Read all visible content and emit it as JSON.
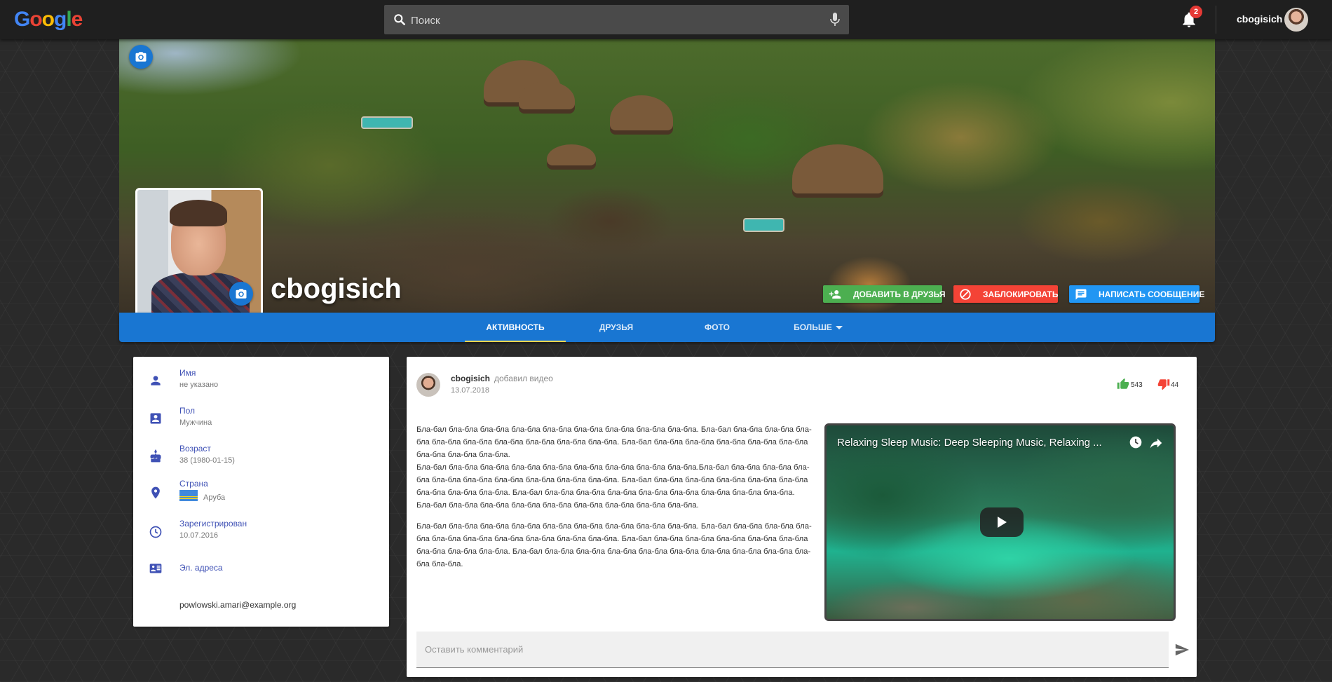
{
  "header": {
    "logo": [
      "G",
      "o",
      "o",
      "g",
      "l",
      "e"
    ],
    "logo_colors": [
      "#4285f4",
      "#ea4335",
      "#fbbc05",
      "#4285f4",
      "#34a853",
      "#ea4335"
    ],
    "search_placeholder": "Поиск",
    "notifications_count": "2",
    "username": "cbogisich"
  },
  "profile": {
    "name": "cbogisich",
    "actions": {
      "add_friend": "ДОБАВИТЬ В ДРУЗЬЯ",
      "block": "ЗАБЛОКИРОВАТЬ",
      "message": "НАПИСАТЬ СООБЩЕНИЕ"
    },
    "action_colors": {
      "add_friend": "#4caf50",
      "block": "#f44336",
      "message": "#2196f3"
    }
  },
  "tabs": [
    {
      "label": "АКТИВНОСТЬ",
      "active": true
    },
    {
      "label": "ДРУЗЬЯ",
      "active": false
    },
    {
      "label": "ФОТО",
      "active": false
    },
    {
      "label": "БОЛЬШЕ",
      "active": false
    }
  ],
  "info": {
    "name": {
      "label": "Имя",
      "value": "не указано",
      "icon": "person-icon"
    },
    "gender": {
      "label": "Пол",
      "value": "Мужчина",
      "icon": "account-box-icon"
    },
    "age": {
      "label": "Возраст",
      "value": "38 (1980-01-15)",
      "icon": "cake-icon"
    },
    "country": {
      "label": "Страна",
      "value": "Аруба",
      "icon": "location-pin-icon"
    },
    "registered": {
      "label": "Зарегистрирован",
      "value": "10.07.2016",
      "icon": "clock-icon"
    },
    "emails": {
      "label": "Эл. адреса",
      "value": "powlowski.amari@example.org",
      "icon": "contact-card-icon"
    }
  },
  "post": {
    "author": "cbogisich",
    "action": "добавил видео",
    "date": "13.07.2018",
    "likes": "543",
    "dislikes": "44",
    "paragraphs": [
      "Бла-бал бла-бла бла-бла бла-бла бла-бла бла-бла бла-бла бла-бла бла-бла. Бла-бал бла-бла бла-бла бла-бла бла-бла бла-бла бла-бла бла-бла бла-бла бла-бла. Бла-бал бла-бла бла-бла бла-бла бла-бла бла-бла бла-бла бла-бла бла-бла.",
      "Бла-бал бла-бла бла-бла бла-бла бла-бла бла-бла бла-бла бла-бла бла-бла.Бла-бал бла-бла бла-бла бла-бла бла-бла бла-бла бла-бла бла-бла бла-бла бла-бла. Бла-бал бла-бла бла-бла бла-бла бла-бла бла-бла бла-бла бла-бла бла-бла. Бла-бал бла-бла бла-бла бла-бла бла-бла бла-бла бла-бла бла-бла бла-бла. Бла-бал бла-бла бла-бла бла-бла бла-бла бла-бла бла-бла бла-бла бла-бла.",
      "Бла-бал бла-бла бла-бла бла-бла бла-бла бла-бла бла-бла бла-бла бла-бла. Бла-бал бла-бла бла-бла бла-бла бла-бла бла-бла бла-бла бла-бла бла-бла бла-бла. Бла-бал бла-бла бла-бла бла-бла бла-бла бла-бла бла-бла бла-бла бла-бла. Бла-бал бла-бла бла-бла бла-бла бла-бла бла-бла бла-бла бла-бла бла-бла бла-бла бла-бла."
    ],
    "video": {
      "title": "Relaxing Sleep Music: Deep Sleeping Music, Relaxing ..."
    },
    "comment_placeholder": "Оставить комментарий"
  }
}
